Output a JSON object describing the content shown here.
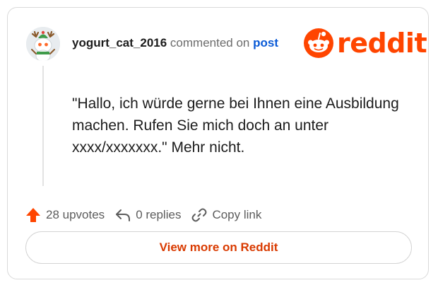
{
  "comment": {
    "username": "yogurt_cat_2016",
    "action_text": "commented on",
    "post_link_label": "post",
    "body": "\"Hallo, ich würde gerne bei Ihnen eine Ausbildung machen. Rufen Sie mich doch an unter xxxx/xxxxxxx.\" Mehr nicht."
  },
  "brand": {
    "logo_text": "reddit",
    "color": "#ff4500"
  },
  "actions": {
    "upvotes_label": "28 upvotes",
    "replies_label": "0 replies",
    "copy_link_label": "Copy link"
  },
  "footer": {
    "view_more_label": "View more on Reddit"
  },
  "icons": [
    "avatar-icon",
    "reddit-logo-icon",
    "upvote-arrow-icon",
    "reply-icon",
    "link-icon"
  ]
}
